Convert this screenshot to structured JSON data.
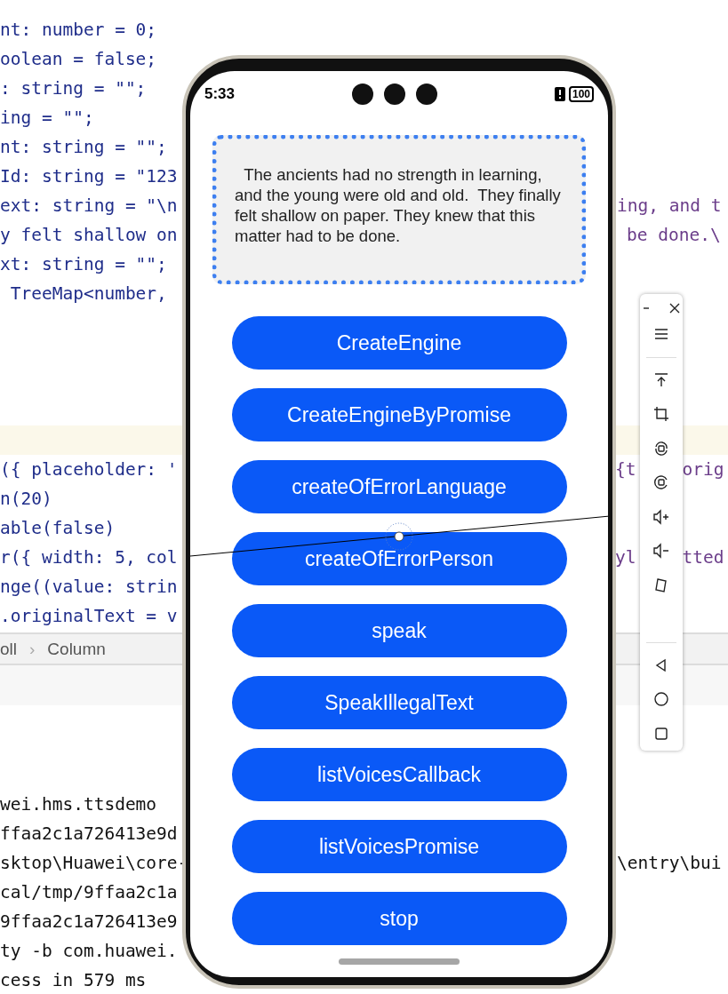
{
  "editor": {
    "lines": [
      {
        "left": "nt: number = 0;"
      },
      {
        "left": "oolean = false;"
      },
      {
        "left": ": string = \"\";"
      },
      {
        "left": "ing = \"\";"
      },
      {
        "left": "nt: string = \"\";"
      },
      {
        "left": "Id: string = \"123"
      },
      {
        "left": "ext: string = \"\\n",
        "right": [
          "ing, and t"
        ]
      },
      {
        "left": "y felt shallow on",
        "right": [
          "be done.\\"
        ]
      },
      {
        "left": "xt: string = \"\";"
      },
      {
        "left": " TreeMap<number,"
      },
      {
        "highlighted": false
      },
      {
        "highlighted": false
      },
      {
        "highlighted": false
      },
      {
        "highlighted": false
      },
      {
        "highlighted": true
      },
      {
        "left": "({ placeholder: '",
        "right": [
          "{t",
          "orig"
        ]
      },
      {
        "left": "n(20)"
      },
      {
        "left": "able(false)"
      },
      {
        "left": "r({ width: 5, col",
        "right": [
          "yl",
          "tted"
        ]
      },
      {
        "left": "nge((value: strin"
      },
      {
        "left": ".originalText = v"
      }
    ]
  },
  "breadcrumb": [
    "oll",
    "›",
    "Column"
  ],
  "console": {
    "lines": [
      {
        "left": "wei.hms.ttsdemo"
      },
      {
        "left": "ffaa2c1a726413e9d"
      },
      {
        "left": "sktop\\Huawei\\core-",
        "right": "\\entry\\bui"
      },
      {
        "left": "cal/tmp/9ffaa2c1a"
      },
      {
        "left": "9ffaa2c1a726413e9"
      },
      {
        "left": "ty -b com.huawei."
      },
      {
        "left": "cess in 579 ms"
      }
    ]
  },
  "phone": {
    "status_bar": {
      "time": "5:33",
      "battery": "100"
    },
    "text_area": {
      "value": "  The ancients had no strength in learning, and the young were old and old.  They finally felt shallow on paper. They knew that this matter had to be done."
    },
    "buttons": [
      "CreateEngine",
      "CreateEngineByPromise",
      "createOfErrorLanguage",
      "createOfErrorPerson",
      "speak",
      "SpeakIllegalText",
      "listVoicesCallback",
      "listVoicesPromise",
      "stop"
    ]
  }
}
